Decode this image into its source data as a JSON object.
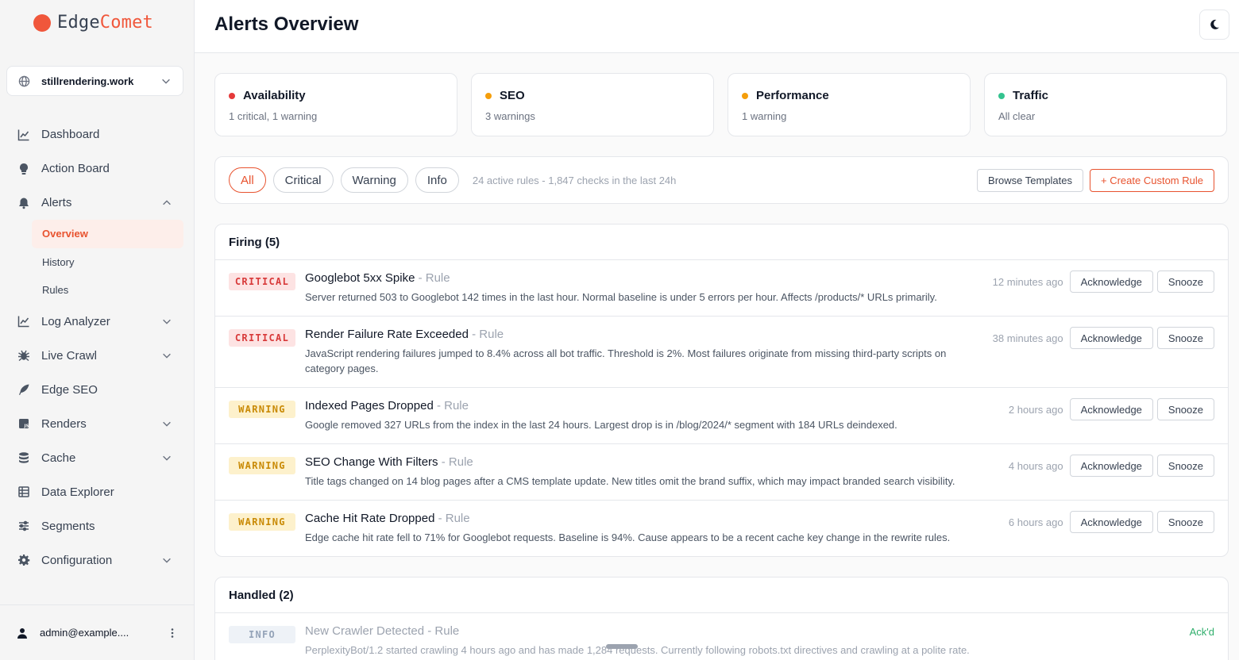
{
  "app": {
    "logo_part1": "Edge",
    "logo_part2": "Comet"
  },
  "site_selector": {
    "value": "stillrendering.work"
  },
  "nav": {
    "dashboard": "Dashboard",
    "action_board": "Action Board",
    "alerts": "Alerts",
    "alerts_sub": {
      "overview": "Overview",
      "history": "History",
      "rules": "Rules"
    },
    "log_analyzer": "Log Analyzer",
    "live_crawl": "Live Crawl",
    "edge_seo": "Edge SEO",
    "renders": "Renders",
    "cache": "Cache",
    "data_explorer": "Data Explorer",
    "segments": "Segments",
    "configuration": "Configuration"
  },
  "user": {
    "email": "admin@example...."
  },
  "header": {
    "title": "Alerts Overview"
  },
  "summary_cards": [
    {
      "title": "Availability",
      "sub": "1 critical, 1 warning",
      "color": "#e5393a"
    },
    {
      "title": "SEO",
      "sub": "3 warnings",
      "color": "#f59e0b"
    },
    {
      "title": "Performance",
      "sub": "1 warning",
      "color": "#f59e0b"
    },
    {
      "title": "Traffic",
      "sub": "All clear",
      "color": "#34c38f"
    }
  ],
  "filters": {
    "chips": [
      "All",
      "Critical",
      "Warning",
      "Info"
    ],
    "note": "24 active rules - 1,847 checks in the last 24h",
    "browse_label": "Browse Templates",
    "create_label": "+ Create Custom Rule"
  },
  "firing": {
    "title": "Firing (5)",
    "acknowledge_label": "Acknowledge",
    "snooze_label": "Snooze",
    "alerts": [
      {
        "severity": "CRITICAL",
        "title": "Googlebot 5xx Spike",
        "rule": "- Rule",
        "desc": "Server returned 503 to Googlebot 142 times in the last hour. Normal baseline is under 5 errors per hour. Affects /products/* URLs primarily.",
        "time": "12 minutes ago"
      },
      {
        "severity": "CRITICAL",
        "title": "Render Failure Rate Exceeded",
        "rule": "- Rule",
        "desc": "JavaScript rendering failures jumped to 8.4% across all bot traffic. Threshold is 2%. Most failures originate from missing third-party scripts on category pages.",
        "time": "38 minutes ago"
      },
      {
        "severity": "WARNING",
        "title": "Indexed Pages Dropped",
        "rule": "- Rule",
        "desc": "Google removed 327 URLs from the index in the last 24 hours. Largest drop is in /blog/2024/* segment with 184 URLs deindexed.",
        "time": "2 hours ago"
      },
      {
        "severity": "WARNING",
        "title": "SEO Change With Filters",
        "rule": "- Rule",
        "desc": "Title tags changed on 14 blog pages after a CMS template update. New titles omit the brand suffix, which may impact branded search visibility.",
        "time": "4 hours ago"
      },
      {
        "severity": "WARNING",
        "title": "Cache Hit Rate Dropped",
        "rule": "- Rule",
        "desc": "Edge cache hit rate fell to 71% for Googlebot requests. Baseline is 94%. Cause appears to be a recent cache key change in the rewrite rules.",
        "time": "6 hours ago"
      }
    ]
  },
  "handled": {
    "title": "Handled (2)",
    "alerts": [
      {
        "severity": "INFO",
        "title": "New Crawler Detected",
        "rule": "- Rule",
        "desc": "PerplexityBot/1.2 started crawling 4 hours ago and has made 1,284 requests. Currently following robots.txt directives and crawling at a polite rate.",
        "status": "Ack'd"
      }
    ]
  }
}
